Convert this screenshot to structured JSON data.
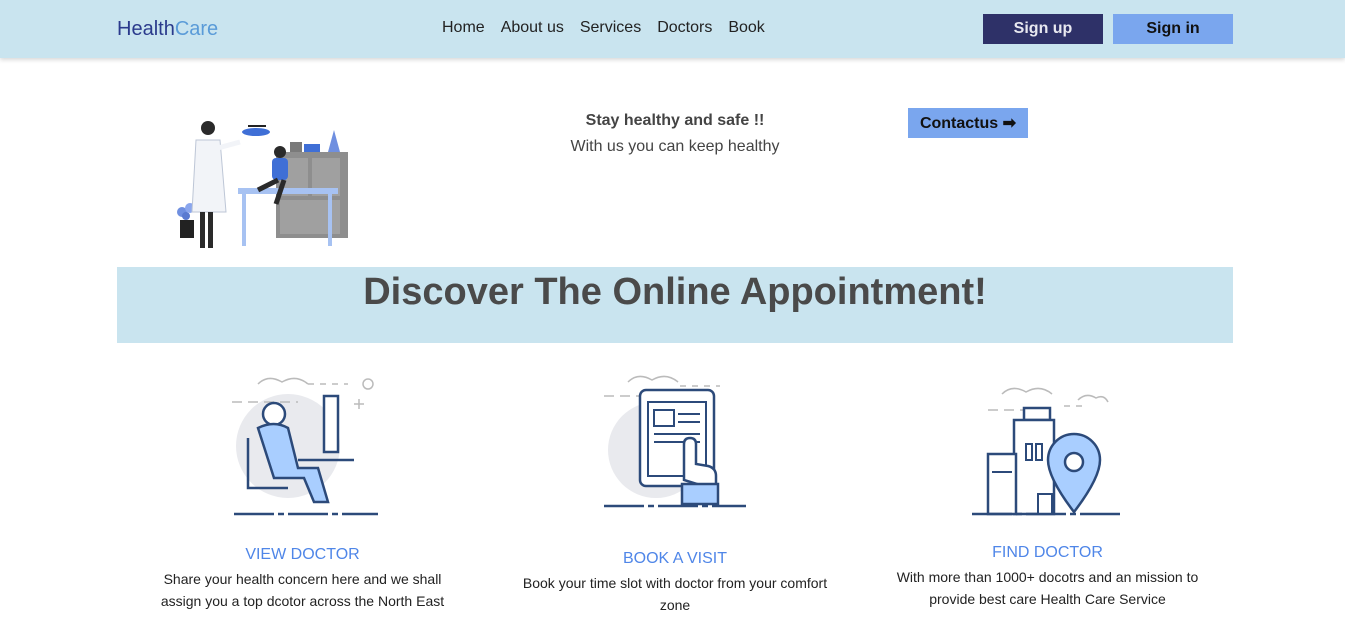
{
  "header": {
    "logo_part1": "Health",
    "logo_part2": "Care",
    "nav": [
      "Home",
      "About us",
      "Services",
      "Doctors",
      "Book"
    ],
    "signup_label": "Sign up",
    "signin_label": "Sign in"
  },
  "hero": {
    "tagline_strong": "Stay healthy and safe !!",
    "tagline_text": "With us you can keep healthy",
    "contact_label": "Contactus ➡"
  },
  "banner": {
    "title": "Discover The Online Appointment!"
  },
  "features": [
    {
      "title": "VIEW DOCTOR",
      "description": "Share your health concern here and we shall assign you a top dcotor across the North East",
      "icon": "doctor-at-desk-icon"
    },
    {
      "title": "BOOK A VISIT",
      "description": "Book your time slot with doctor from your comfort zone",
      "icon": "tablet-booking-icon"
    },
    {
      "title": "FIND DOCTOR",
      "description": "With more than 1000+ docotrs and an mission to provide best care Health Care Service",
      "icon": "location-building-icon"
    }
  ],
  "colors": {
    "header_bg": "#c9e4ef",
    "signup_bg": "#2e3168",
    "signin_bg": "#7aa6ee",
    "feature_title": "#4f86e8"
  }
}
